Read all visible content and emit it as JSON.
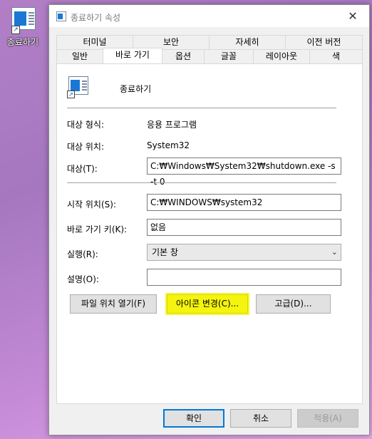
{
  "desktop": {
    "shortcut_label": "종료하기"
  },
  "dialog": {
    "title": "종료하기 속성",
    "close_glyph": "✕",
    "tabs_row1": [
      "터미널",
      "보안",
      "자세히",
      "이전 버전"
    ],
    "tabs_row2": [
      "일반",
      "바로 가기",
      "옵션",
      "글꼴",
      "레이아웃",
      "색"
    ],
    "active_tab": "바로 가기",
    "shortcut_name": "종료하기",
    "target_type_label": "대상 형식:",
    "target_type_value": "응용 프로그램",
    "target_location_label": "대상 위치:",
    "target_location_value": "System32",
    "target_label": "대상(T):",
    "target_value": "C:₩Windows₩System32₩shutdown.exe -s -t 0",
    "start_in_label": "시작 위치(S):",
    "start_in_value": "C:₩WINDOWS₩system32",
    "hotkey_label": "바로 가기 키(K):",
    "hotkey_value": "없음",
    "run_label": "실행(R):",
    "run_value": "기본 창",
    "comment_label": "설명(O):",
    "comment_value": "",
    "buttons": {
      "open_location": "파일 위치 열기(F)",
      "change_icon": "아이콘 변경(C)...",
      "advanced": "고급(D)..."
    },
    "footer": {
      "ok": "확인",
      "cancel": "취소",
      "apply": "적용(A)"
    }
  },
  "colors": {
    "highlight": "#f4f40f",
    "accent": "#0078d7",
    "desktop": "#b27fc7"
  },
  "icons": [
    "shortcut-app-icon",
    "close-icon",
    "chevron-down-icon",
    "shortcut-arrow-icon"
  ]
}
